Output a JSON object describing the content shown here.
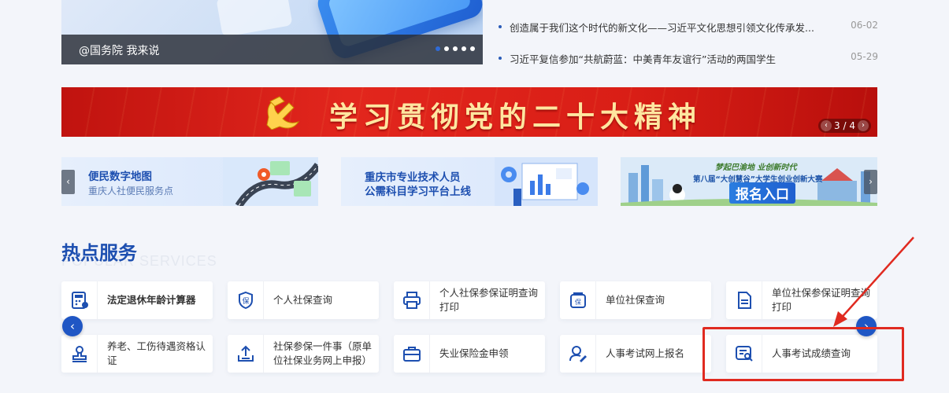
{
  "hero": {
    "caption": "@国务院 我来说",
    "dots": 5,
    "active_dot": 0
  },
  "news": [
    {
      "title": "创造属于我们这个时代的新文化——习近平文化思想引领文化传承发...",
      "date": "06-02"
    },
    {
      "title": "习近平复信参加“共航蔚蓝：中美青年友谊行”活动的两国学生",
      "date": "05-29"
    }
  ],
  "banner": {
    "slogan": "学习贯彻党的二十大精神",
    "pager": "3 / 4",
    "prev": "‹",
    "next": "›"
  },
  "cards": {
    "card1": {
      "title": "便民数字地图",
      "subtitle": "重庆人社便民服务点"
    },
    "card2": {
      "line1": "重庆市专业技术人员",
      "line2": "公需科目学习平台上线"
    },
    "card3": {
      "slogan_a": "梦起巴渝地 业创新时代",
      "slogan_b": "第八届“大创慧谷”大学生创业创新大赛",
      "entry": "报名入口"
    },
    "left_arrow": "‹",
    "right_arrow": "›"
  },
  "services": {
    "title": "热点服务",
    "subtitle": "POPULAR SERVICES",
    "prev": "‹",
    "next": "›",
    "items": [
      {
        "label": "法定退休年龄计算器",
        "icon": "calculator-icon",
        "bold": true
      },
      {
        "label": "个人社保查询",
        "icon": "shield-badge-icon"
      },
      {
        "label": "个人社保参保证明查询打印",
        "icon": "printer-icon"
      },
      {
        "label": "单位社保查询",
        "icon": "wallet-shield-icon"
      },
      {
        "label": "单位社保参保证明查询打印",
        "icon": "document-icon"
      },
      {
        "label": "养老、工伤待遇资格认证",
        "icon": "stamp-icon"
      },
      {
        "label": "社保参保一件事（原单位社保业务网上申报）",
        "icon": "upload-icon"
      },
      {
        "label": "失业保险金申领",
        "icon": "briefcase-icon"
      },
      {
        "label": "人事考试网上报名",
        "icon": "user-edit-icon"
      },
      {
        "label": "人事考试成绩查询",
        "icon": "search-doc-icon"
      }
    ]
  },
  "colors": {
    "brand_blue": "#1d4fb0",
    "banner_red": "#d91e16",
    "highlight_red": "#e02a20"
  }
}
